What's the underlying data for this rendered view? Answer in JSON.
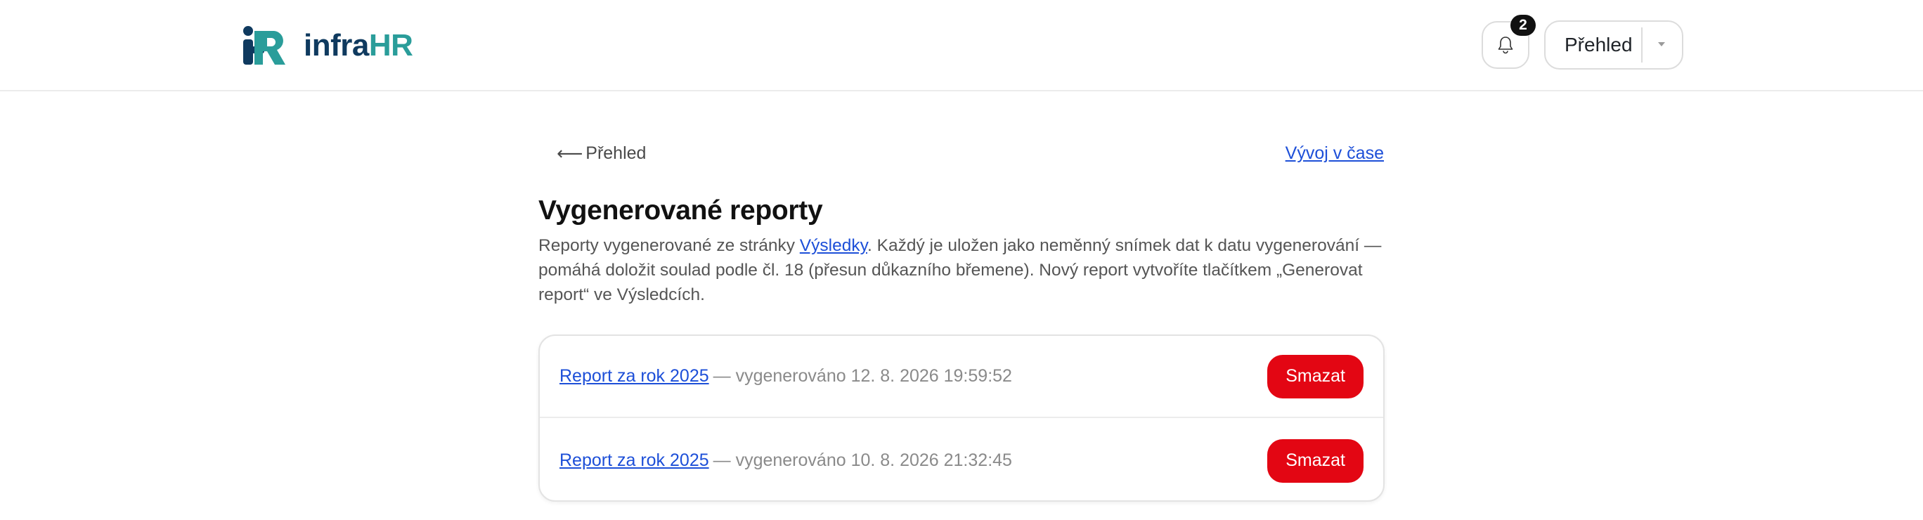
{
  "brand": {
    "name_prefix": "infra",
    "name_suffix": "HR",
    "colors": {
      "dark": "#0f3a5f",
      "teal": "#2a9d9a"
    }
  },
  "header": {
    "notification_count": "2",
    "view_select": {
      "selected": "Přehled"
    }
  },
  "nav": {
    "back_label": "Přehled",
    "trend_link": "Vývoj v čase"
  },
  "page": {
    "title": "Vygenerované reporty",
    "intro_before": "Reporty vygenerované ze stránky ",
    "intro_link": "Výsledky",
    "intro_after": ". Každý je uložen jako neměnný snímek dat k datu vygenerování — pomáhá doložit soulad podle čl. 18 (přesun důkazního břemene). Nový report vytvoříte tlačítkem „Generovat report“ ve Výsledcích."
  },
  "reports": [
    {
      "name": "Report za rok 2025",
      "meta": "— vygenerováno 12. 8. 2026 19:59:52",
      "delete_label": "Smazat"
    },
    {
      "name": "Report za rok 2025",
      "meta": "— vygenerováno 10. 8. 2026 21:32:45",
      "delete_label": "Smazat"
    }
  ],
  "colors": {
    "link": "#1d4fd8",
    "danger": "#e30613"
  }
}
